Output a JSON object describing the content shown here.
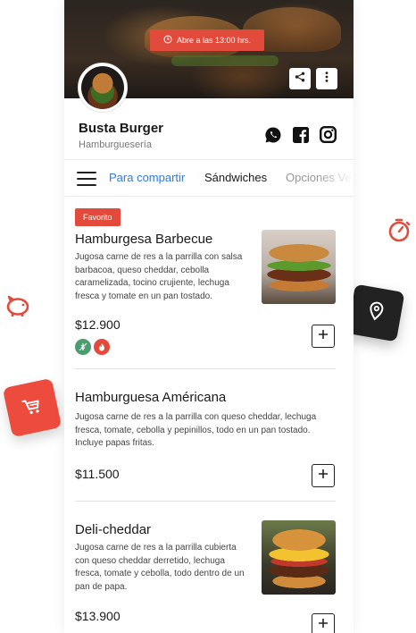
{
  "store": {
    "hours_badge": "Abre a las 13:00 hrs.",
    "name": "Busta Burger",
    "category": "Hamburguesería"
  },
  "tabs": [
    "Para compartir",
    "Sándwiches",
    "Opciones Veg"
  ],
  "active_tab": 0,
  "badge": "Favorito",
  "items": [
    {
      "title": "Hamburgesa Barbecue",
      "description": "Jugosa carne de res a la parrilla con salsa barbacoa, queso cheddar, cebolla caramelizada, tocino crujiente, lechuga fresca y tomate en un pan tostado.",
      "price": "$12.900"
    },
    {
      "title": "Hamburguesa Américana",
      "description": "Jugosa carne de res a la parrilla con queso cheddar, lechuga fresca, tomate, cebolla y pepinillos, todo en un pan tostado. Incluye papas fritas.",
      "price": "$11.500"
    },
    {
      "title": "Deli-cheddar",
      "description": "Jugosa carne de res a la parrilla cubierta con queso cheddar derretido, lechuga fresca, tomate y cebolla, todo dentro de un pan de papa.",
      "price": "$13.900"
    }
  ],
  "icons": {
    "hero_buttons": [
      "share-icon",
      "more-vertical-icon"
    ],
    "social": [
      "whatsapp-icon",
      "facebook-icon",
      "instagram-icon"
    ],
    "item_tags": [
      "no-gluten-icon",
      "spicy-icon"
    ],
    "floating": [
      "timer-icon",
      "piggy-bank-icon",
      "cart-icon",
      "location-pin-icon"
    ]
  },
  "colors": {
    "accent_red": "#e24b3c",
    "active_tab_blue": "#2f7ae5",
    "tag_green": "#4a9d6e",
    "tag_red": "#e5493c",
    "dark_tile": "#222222"
  }
}
